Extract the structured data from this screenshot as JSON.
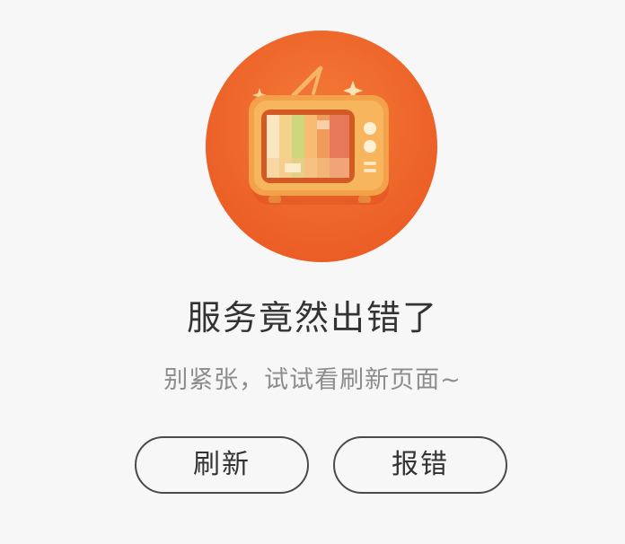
{
  "error": {
    "title": "服务竟然出错了",
    "subtitle": "别紧张，试试看刷新页面~"
  },
  "actions": {
    "refresh_label": "刷新",
    "report_label": "报错"
  },
  "illustration": {
    "icon": "retro-tv-icon"
  },
  "colors": {
    "circle_orange": "#ef6a2f",
    "tv_frame": "#f4a24a",
    "text_primary": "#333333",
    "text_secondary": "#8c8c8c",
    "button_border": "#4a4a4a",
    "background": "#f7f7f7"
  }
}
